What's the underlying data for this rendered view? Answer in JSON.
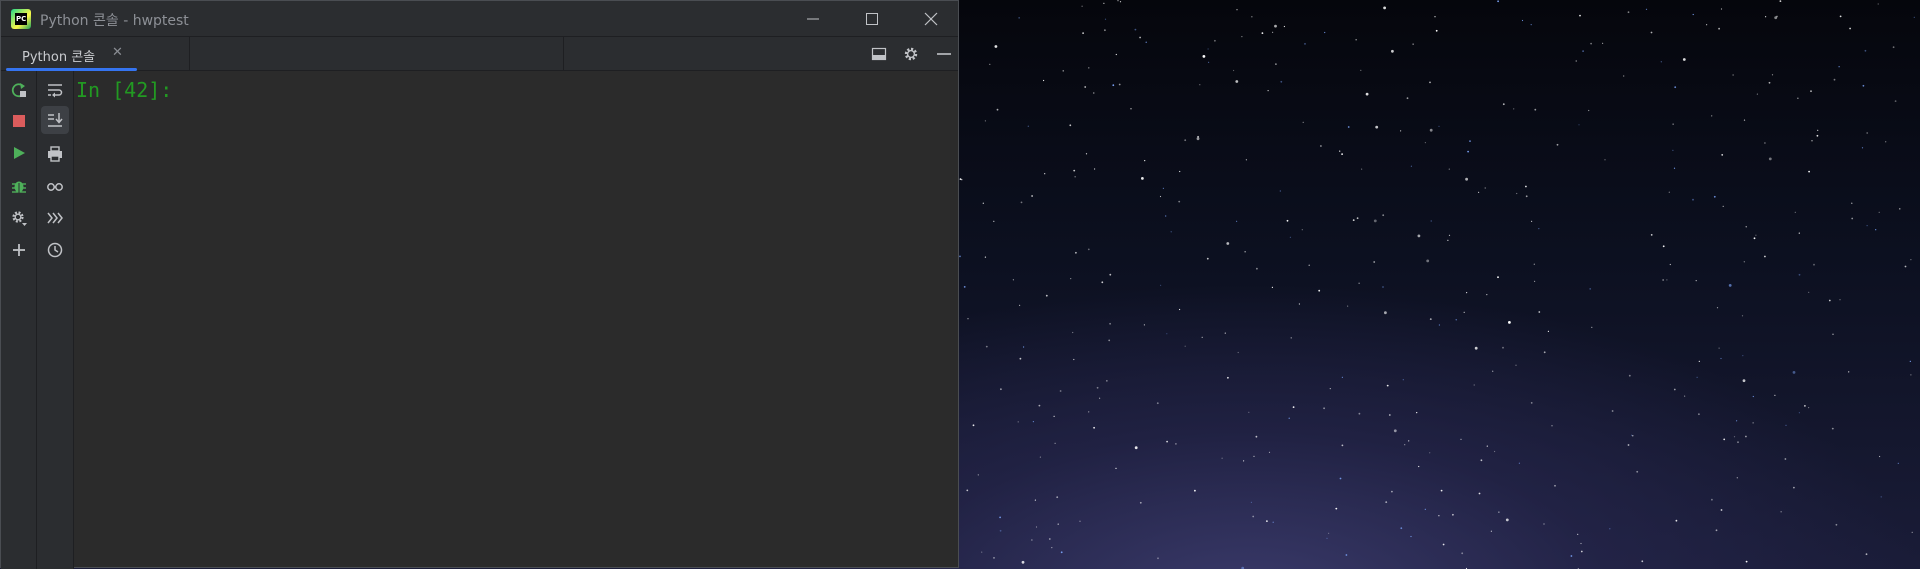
{
  "window": {
    "title": "Python 콘솔 - hwptest",
    "app_icon_label": "PC",
    "controls": [
      "minimize-icon",
      "maximize-icon",
      "close-icon"
    ]
  },
  "tabs": [
    {
      "label": "Python 콘솔",
      "close_glyph": "✕",
      "active": true
    }
  ],
  "tab_toolbar": [
    "layout-icon",
    "gear-icon",
    "minus-icon"
  ],
  "left_toolbar": [
    "rerun-icon",
    "stop-icon",
    "run-icon",
    "debug-icon",
    "settings-icon",
    "add-icon"
  ],
  "secondary_toolbar": [
    "soft-wrap-icon",
    "scroll-to-end-icon",
    "print-icon",
    "variables-icon",
    "execute-icon",
    "history-icon"
  ],
  "console": {
    "prompt": "In [42]:"
  },
  "colors": {
    "window_bg": "#2b2b2b",
    "chrome_bg": "#2b2d30",
    "accent": "#3574f0",
    "prompt_green": "#229a22",
    "run_green": "#4eb05a",
    "stop_red": "#db5c5c"
  }
}
